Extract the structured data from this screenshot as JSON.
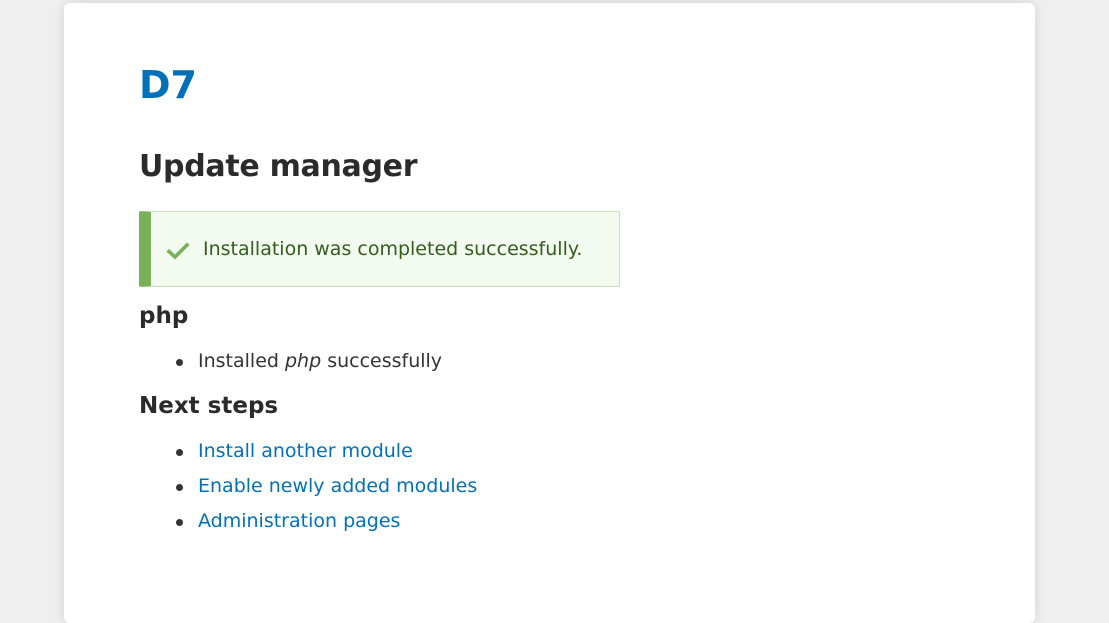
{
  "site": {
    "name": "D7"
  },
  "page": {
    "title": "Update manager"
  },
  "status_message": {
    "icon": "check-icon",
    "text": "Installation was completed successfully."
  },
  "project": {
    "heading": "php",
    "result_prefix": "Installed ",
    "result_name": "php",
    "result_suffix": " successfully"
  },
  "next_steps": {
    "heading": "Next steps",
    "links": [
      "Install another module",
      "Enable newly added modules",
      "Administration pages"
    ]
  },
  "colors": {
    "link": "#0071b8",
    "success_border": "#77b259",
    "success_bg": "#f3faef",
    "success_text": "#325e1c"
  }
}
